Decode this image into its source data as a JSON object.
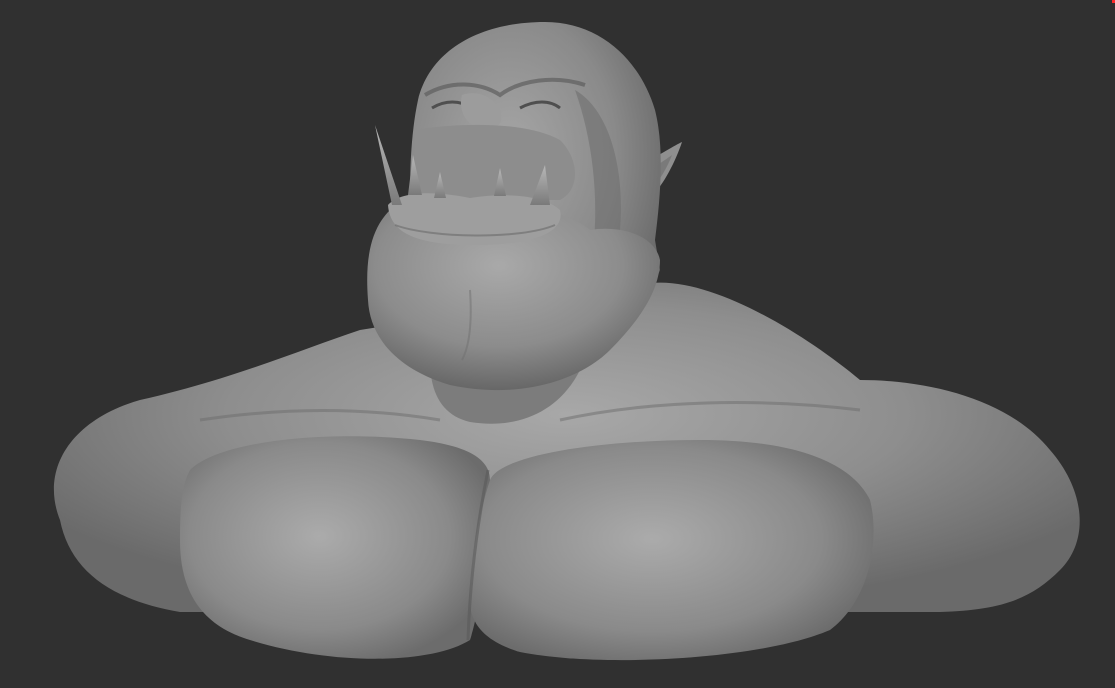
{
  "viewport": {
    "background_color": "#303030",
    "indicator_color": "#ff2a2a"
  },
  "model": {
    "subject": "orc-bust",
    "material_color": "#8c8c8c",
    "parts": [
      "head",
      "ear",
      "tusks",
      "neck",
      "shoulders",
      "chest"
    ]
  }
}
